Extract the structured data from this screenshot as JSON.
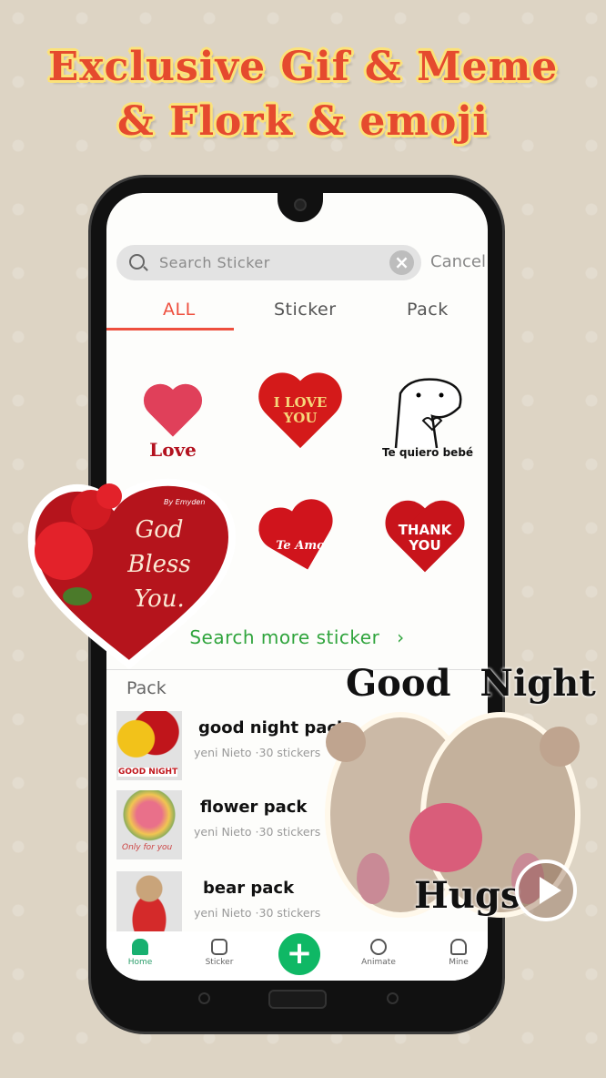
{
  "headline": {
    "line1": "Exclusive Gif & Meme",
    "line2": "& Flork & emoji"
  },
  "search": {
    "placeholder": "Search Sticker",
    "cancel_label": "Cancel"
  },
  "tabs": [
    {
      "label": "ALL",
      "active": true
    },
    {
      "label": "Sticker",
      "active": false
    },
    {
      "label": "Pack",
      "active": false
    }
  ],
  "stickers": [
    {
      "text": "Love",
      "color": "#d8283a"
    },
    {
      "text": "I LOVE YOU",
      "color": "#d41a1a"
    },
    {
      "text": "Te quiero bebé",
      "color": "#111111"
    },
    {
      "text": "",
      "color": "#c7111b"
    },
    {
      "text": "Te Amo",
      "color": "#d0141c"
    },
    {
      "text": "THANK YOU",
      "color": "#c8141b"
    }
  ],
  "search_more_label": "Search more sticker",
  "pack_section_label": "Pack",
  "packs": [
    {
      "name": "good night pack",
      "author": "yeni Nieto",
      "count": "·30 stickers",
      "thumb_text": "GOOD NIGHT"
    },
    {
      "name": "flower pack",
      "author": "yeni Nieto",
      "count": "·30 stickers",
      "thumb_text": "Only for you"
    },
    {
      "name": "bear pack",
      "author": "yeni Nieto",
      "count": "·30 stickers",
      "thumb_text": ""
    }
  ],
  "nav": {
    "home": "Home",
    "sticker": "Sticker",
    "animate": "Animate",
    "mine": "Mine"
  },
  "overlay_god_bless": {
    "signature": "By Emyden",
    "text": "God Bless You."
  },
  "overlay_good_night": {
    "title": "Good Night",
    "subtitle": "Hugs"
  },
  "colors": {
    "accent_tab": "#ee4f3e",
    "green": "#2fa43c",
    "fab": "#0fb865",
    "headline": "#e54a2e"
  }
}
